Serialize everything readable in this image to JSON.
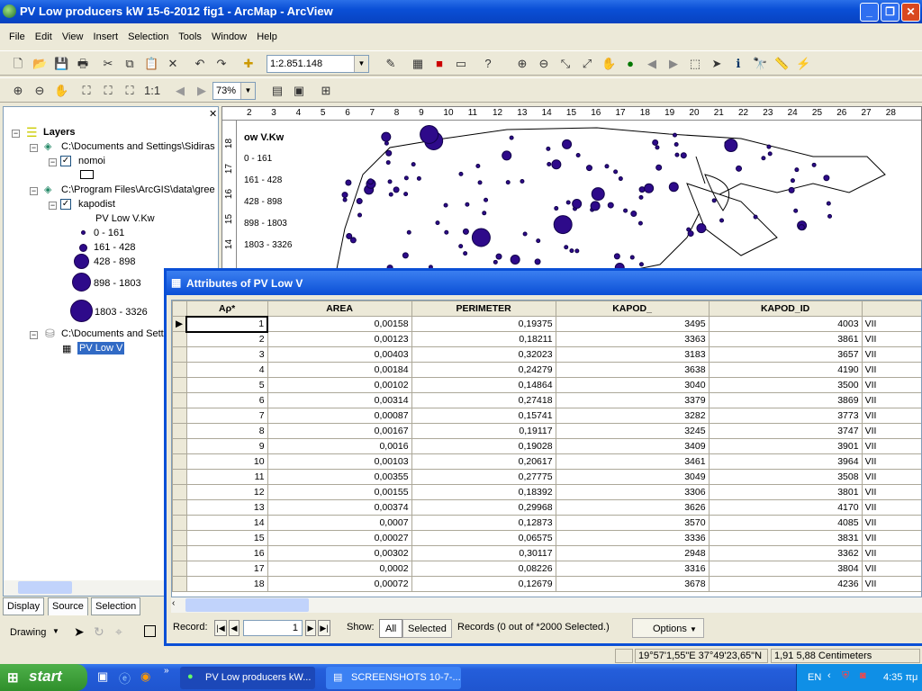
{
  "window": {
    "title": "PV Low producers kW 15-6-2012 fig1 - ArcMap - ArcView",
    "minimize": "_",
    "maximize": "❐",
    "close": "✕"
  },
  "menu": [
    "File",
    "Edit",
    "View",
    "Insert",
    "Selection",
    "Tools",
    "Window",
    "Help"
  ],
  "toolbar": {
    "scale": "1:2.851.148",
    "zoom": "73%"
  },
  "toc": {
    "root": "Layers",
    "frame1": "C:\\Documents and Settings\\Sidiras",
    "layer1": "nomoi",
    "frame2": "C:\\Program Files\\ArcGIS\\data\\gree",
    "layer2": "kapodist",
    "legend_title": "PV Low V.Kw",
    "classes": [
      "0 - 161",
      "161 - 428",
      "428 - 898",
      "898 - 1803",
      "1803 - 3326"
    ],
    "frame3": "C:\\Documents and Settings",
    "table": "PV Low V",
    "symbol_color": "#2e0a8a"
  },
  "tabs": [
    "Display",
    "Source",
    "Selection"
  ],
  "drawing": {
    "label": "Drawing"
  },
  "map": {
    "legend_title": "ow V.Kw",
    "classes": [
      "0 - 161",
      "161 - 428",
      "428 - 898",
      "898 - 1803",
      "1803 - 3326"
    ],
    "ruler_top": [
      "2",
      "3",
      "4",
      "5",
      "6",
      "7",
      "8",
      "9",
      "10",
      "11",
      "12",
      "13",
      "14",
      "15",
      "16",
      "17",
      "18",
      "19",
      "20",
      "21",
      "22",
      "23",
      "24",
      "25",
      "26",
      "27",
      "28"
    ],
    "ruler_left": [
      "18",
      "17",
      "16",
      "15",
      "14"
    ]
  },
  "attributes": {
    "title": "Attributes of PV Low V",
    "columns": [
      "Αρ*",
      "AREA",
      "PERIMETER",
      "KAPOD_",
      "KAPOD_ID",
      ""
    ],
    "rows": [
      [
        "1",
        "0,00158",
        "0,19375",
        "3495",
        "4003",
        "VII"
      ],
      [
        "2",
        "0,00123",
        "0,18211",
        "3363",
        "3861",
        "VII"
      ],
      [
        "3",
        "0,00403",
        "0,32023",
        "3183",
        "3657",
        "VII"
      ],
      [
        "4",
        "0,00184",
        "0,24279",
        "3638",
        "4190",
        "VII"
      ],
      [
        "5",
        "0,00102",
        "0,14864",
        "3040",
        "3500",
        "VII"
      ],
      [
        "6",
        "0,00314",
        "0,27418",
        "3379",
        "3869",
        "VII"
      ],
      [
        "7",
        "0,00087",
        "0,15741",
        "3282",
        "3773",
        "VII"
      ],
      [
        "8",
        "0,00167",
        "0,19117",
        "3245",
        "3747",
        "VII"
      ],
      [
        "9",
        "0,0016",
        "0,19028",
        "3409",
        "3901",
        "VII"
      ],
      [
        "10",
        "0,00103",
        "0,20617",
        "3461",
        "3964",
        "VII"
      ],
      [
        "11",
        "0,00355",
        "0,27775",
        "3049",
        "3508",
        "VII"
      ],
      [
        "12",
        "0,00155",
        "0,18392",
        "3306",
        "3801",
        "VII"
      ],
      [
        "13",
        "0,00374",
        "0,29968",
        "3626",
        "4170",
        "VII"
      ],
      [
        "14",
        "0,0007",
        "0,12873",
        "3570",
        "4085",
        "VII"
      ],
      [
        "15",
        "0,00027",
        "0,06575",
        "3336",
        "3831",
        "VII"
      ],
      [
        "16",
        "0,00302",
        "0,30117",
        "2948",
        "3362",
        "VII"
      ],
      [
        "17",
        "0,0002",
        "0,08226",
        "3316",
        "3804",
        "VII"
      ],
      [
        "18",
        "0,00072",
        "0,12679",
        "3678",
        "4236",
        "VII"
      ]
    ],
    "footer": {
      "record_label": "Record:",
      "record_value": "1",
      "show_label": "Show:",
      "all": "All",
      "selected": "Selected",
      "records_text": "Records  (0 out of *2000 Selected.)",
      "options": "Options"
    }
  },
  "status": {
    "coords": "19°57'1,55\"E  37°49'23,65\"N",
    "measure": "1,91  5,88 Centimeters"
  },
  "taskbar": {
    "start": "start",
    "tasks": [
      "PV Low producers kW...",
      "SCREENSHOTS 10-7-..."
    ],
    "lang": "EN",
    "clock": "4:35 πμ"
  }
}
